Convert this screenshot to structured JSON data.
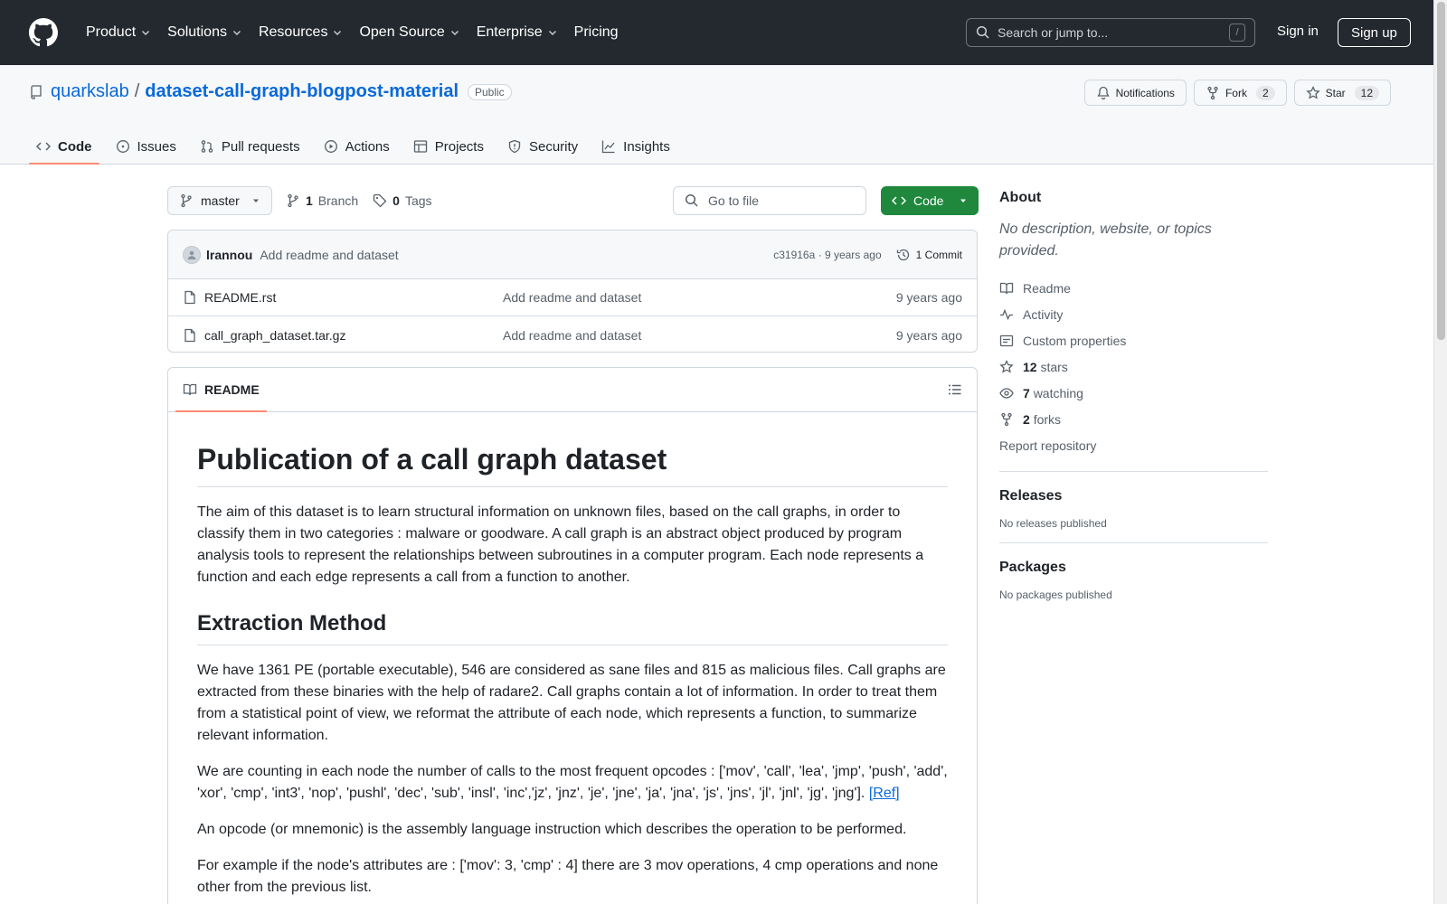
{
  "header": {
    "nav": [
      "Product",
      "Solutions",
      "Resources",
      "Open Source",
      "Enterprise",
      "Pricing"
    ],
    "search_placeholder": "Search or jump to...",
    "search_kbd": "/",
    "signin": "Sign in",
    "signup": "Sign up"
  },
  "repo": {
    "owner": "quarkslab",
    "separator": "/",
    "name": "dataset-call-graph-blogpost-material",
    "visibility": "Public",
    "notifications_label": "Notifications",
    "fork_label": "Fork",
    "fork_count": "2",
    "star_label": "Star",
    "star_count": "12"
  },
  "tabs": [
    "Code",
    "Issues",
    "Pull requests",
    "Actions",
    "Projects",
    "Security",
    "Insights"
  ],
  "toolbar": {
    "branch": "master",
    "branch_count": "1",
    "branch_label": "Branch",
    "tag_count": "0",
    "tag_label": "Tags",
    "goto_placeholder": "Go to file",
    "code_button": "Code"
  },
  "commit": {
    "author": "lrannou",
    "message": "Add readme and dataset",
    "hash_time": "c31916a · 9 years ago",
    "commits": "1 Commit"
  },
  "files": [
    {
      "name": "README.rst",
      "message": "Add readme and dataset",
      "date": "9 years ago"
    },
    {
      "name": "call_graph_dataset.tar.gz",
      "message": "Add readme and dataset",
      "date": "9 years ago"
    }
  ],
  "readme": {
    "tab": "README",
    "h1": "Publication of a call graph dataset",
    "p1": "The aim of this dataset is to learn structural information on unknown files, based on the call graphs, in order to classify them in two categories : malware or goodware. A call graph is an abstract object produced by program analysis tools to represent the relationships between subroutines in a computer program. Each node represents a function and each edge represents a call from a function to another.",
    "h2": "Extraction Method",
    "p2": "We have 1361 PE (portable executable), 546 are considered as sane files and 815 as malicious files. Call graphs are extracted from these binaries with the help of radare2. Call graphs contain a lot of information. In order to treat them from a statistical point of view, we reformat the attribute of each node, which represents a function, to summarize relevant information.",
    "p3": "We are counting in each node the number of calls to the most frequent opcodes : ['mov', 'call', 'lea', 'jmp', 'push', 'add', 'xor', 'cmp', 'int3', 'nop', 'pushl', 'dec', 'sub', 'insl', 'inc','jz', 'jnz', 'je', 'jne', 'ja', 'jna', 'js', 'jns', 'jl', 'jnl', 'jg', 'jng'].",
    "p3_link": "[Ref]",
    "p4": "An opcode (or mnemonic) is the assembly language instruction which describes the operation to be performed.",
    "p5": "For example if the node's attributes are : ['mov': 3, 'cmp' : 4] there are 3 mov operations, 4 cmp operations and none other from the previous list."
  },
  "sidebar": {
    "about_title": "About",
    "about_desc": "No description, website, or topics provided.",
    "readme": "Readme",
    "activity": "Activity",
    "custom_props": "Custom properties",
    "stars_count": "12",
    "stars_label": "stars",
    "watching_count": "7",
    "watching_label": "watching",
    "forks_count": "2",
    "forks_label": "forks",
    "report": "Report repository",
    "releases_title": "Releases",
    "releases_desc": "No releases published",
    "packages_title": "Packages",
    "packages_desc": "No packages published"
  }
}
